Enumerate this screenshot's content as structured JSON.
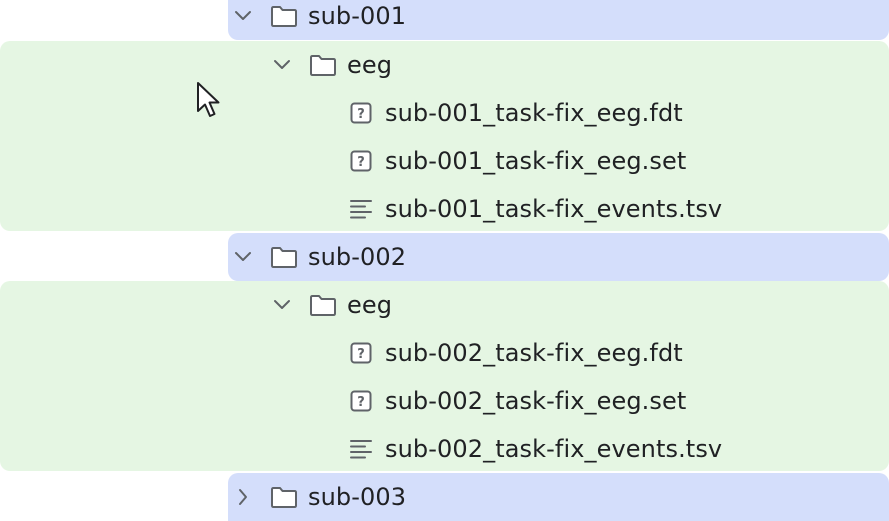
{
  "tree": {
    "subjects": [
      {
        "name": "sub-001",
        "expanded": true,
        "children": [
          {
            "name": "eeg",
            "expanded": true,
            "files": [
              {
                "name": "sub-001_task-fix_eeg.fdt",
                "icon": "unknown-file-icon"
              },
              {
                "name": "sub-001_task-fix_eeg.set",
                "icon": "unknown-file-icon"
              },
              {
                "name": "sub-001_task-fix_events.tsv",
                "icon": "text-file-icon"
              }
            ]
          }
        ]
      },
      {
        "name": "sub-002",
        "expanded": true,
        "children": [
          {
            "name": "eeg",
            "expanded": true,
            "files": [
              {
                "name": "sub-002_task-fix_eeg.fdt",
                "icon": "unknown-file-icon"
              },
              {
                "name": "sub-002_task-fix_eeg.set",
                "icon": "unknown-file-icon"
              },
              {
                "name": "sub-002_task-fix_events.tsv",
                "icon": "text-file-icon"
              }
            ]
          }
        ]
      },
      {
        "name": "sub-003",
        "expanded": false,
        "children": []
      }
    ]
  },
  "colors": {
    "subject_row_bg": "#d4defb",
    "content_bg": "#e5f6e3",
    "icon_stroke": "#5f6368"
  }
}
